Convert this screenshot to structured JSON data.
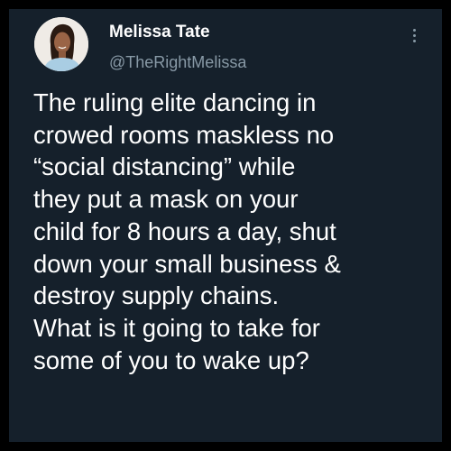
{
  "theme": {
    "background": "#15202b",
    "outer_border": "#000000",
    "primary_text": "#ffffff",
    "secondary_text": "#8899a6"
  },
  "tweet": {
    "author": {
      "display_name": "Melissa Tate",
      "handle": "@TheRightMelissa",
      "avatar_icon": "profile-photo"
    },
    "more_icon": "vertical-ellipsis",
    "text_lines": [
      "The ruling elite dancing in",
      "crowed rooms maskless no",
      "“social distancing” while",
      "they put a mask on your",
      "child for 8 hours a day, shut",
      "down your small business &",
      "destroy supply chains.",
      "What is it going to take for",
      "some of you to wake up?"
    ]
  }
}
